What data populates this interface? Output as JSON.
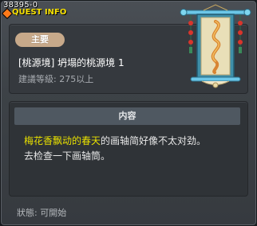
{
  "window": {
    "quest_id": "38395-0",
    "header_title": "QUEST INFO"
  },
  "quest": {
    "category": "主要",
    "title": "[桃源境] 坍塌的桃源境 1",
    "level_requirement": "建議等級: 275以上"
  },
  "content": {
    "header": "内容",
    "line1_highlight": "梅花香飘动的春天",
    "line1_rest": "的画轴简好像不太对劲。",
    "line2": "去检查一下画轴筒。"
  },
  "status": {
    "text": "狀態: 可開始"
  },
  "colors": {
    "header_title": "#f6e000",
    "highlight": "#e8e000",
    "badge": "#c7a98a",
    "content_header": "#4f5861"
  },
  "icons": {
    "header": "quest-diamond-icon",
    "illustration": "hanging-scroll-icon"
  }
}
